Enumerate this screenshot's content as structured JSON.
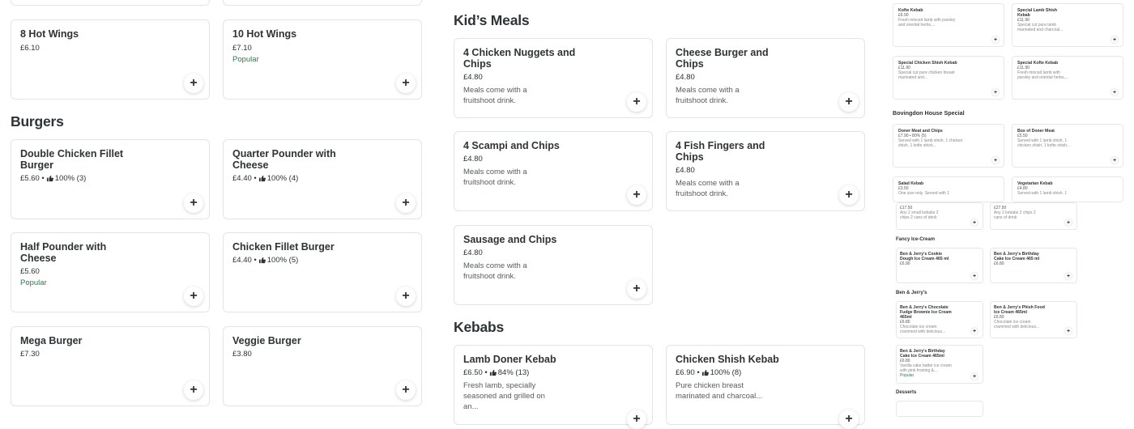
{
  "sections": {
    "burgers": "Burgers",
    "kids_meals": "Kid’s Meals",
    "kebabs": "Kebabs"
  },
  "wings": [
    {
      "title": "8 Hot Wings",
      "price": "£6.10",
      "tag": ""
    },
    {
      "title": "10 Hot Wings",
      "price": "£7.10",
      "tag": "Popular"
    }
  ],
  "burgers": [
    {
      "title": "Double Chicken Fillet Burger",
      "price": "£5.60 •",
      "rating": "100% (3)"
    },
    {
      "title": "Quarter Pounder with Cheese",
      "price": "£4.40 •",
      "rating": "100% (4)"
    },
    {
      "title": "Half Pounder with Cheese",
      "price": "£5.60",
      "tag": "Popular"
    },
    {
      "title": "Chicken Fillet Burger",
      "price": "£4.40 •",
      "rating": "100% (5)"
    },
    {
      "title": "Mega Burger",
      "price": "£7.30"
    },
    {
      "title": "Veggie Burger",
      "price": "£3.80"
    }
  ],
  "kids": [
    {
      "title": "4 Chicken Nuggets and Chips",
      "price": "£4.80",
      "desc": "Meals come with a fruitshoot drink."
    },
    {
      "title": "Cheese Burger and Chips",
      "price": "£4.80",
      "desc": "Meals come with a fruitshoot drink."
    },
    {
      "title": "4 Scampi and Chips",
      "price": "£4.80",
      "desc": "Meals come with a fruitshoot drink."
    },
    {
      "title": "4 Fish Fingers and Chips",
      "price": "£4.80",
      "desc": "Meals come with a fruitshoot drink."
    },
    {
      "title": "Sausage and Chips",
      "price": "£4.80",
      "desc": "Meals come with a fruitshoot drink."
    }
  ],
  "kebabs": [
    {
      "title": "Lamb Doner Kebab",
      "price": "£6.50 •",
      "rating": "84% (13)",
      "desc": "Fresh lamb, specially seasoned and grilled on an..."
    },
    {
      "title": "Chicken Shish Kebab",
      "price": "£6.90 •",
      "rating": "100% (8)",
      "desc": "Pure chicken breast marinated and charcoal..."
    }
  ],
  "plus_label": "+",
  "mini": {
    "top": [
      {
        "title": "Kofte Kebab",
        "price": "£6.90",
        "desc": "Fresh minced lamb with parsley and oriental herbs,..."
      },
      {
        "title": "Special Lamb Shish Kebab",
        "price": "£11.90",
        "desc": "Special cut pure lamb marinated and charcoal..."
      },
      {
        "title": "Special Chicken Shish Kebab",
        "price": "£11.90",
        "desc": "Special cut pure chicken breast marinated and..."
      },
      {
        "title": "Special Kofte Kebab",
        "price": "£11.90",
        "desc": "Fresh minced lamb with parsley and oriental herbs,..."
      }
    ],
    "bovingdon_heading": "Bovingdon House Special",
    "bovingdon": [
      {
        "title": "Doner Meat and Chips",
        "price": "£7.90 • 80% (5)",
        "desc": "Served with 1 lamb shish, 1 chicken shish, 1 kofte shish..."
      },
      {
        "title": "Box of Doner Meat",
        "price": "£5.50",
        "desc": "Served with 1 lamb shish, 1 chicken shish, 1 kofte shish..."
      },
      {
        "title": "Salad Kebab",
        "price": "£3.50",
        "desc": "One size only. Served with 1"
      },
      {
        "title": "Vegetarian Kebab",
        "price": "£4.80",
        "desc": "Served with 1 lamb shish. 1"
      }
    ],
    "small": [
      {
        "price": "£17.50",
        "desc": "Any 2 small kebabs 2 chips 2 cans of drink"
      },
      {
        "price": "£27.50",
        "desc": "Any 2 kebabs 2 chips 2 cans of drink"
      }
    ],
    "icecream_heading": "Fancy Ice-Cream",
    "icecream": [
      {
        "title": "Ben & Jerry's Cookie Dough Ice Cream 465 ml",
        "price": "£6.90"
      },
      {
        "title": "Ben & Jerry's Birthday Cake Ice Cream 465 ml",
        "price": "£6.80"
      }
    ],
    "bj_heading": "Ben & Jerry's",
    "bj": [
      {
        "title": "Ben & Jerry's Chocolate Fudge Brownie Ice Cream 465ml",
        "price": "£6.80",
        "desc": "Chocolate ice cream crammed with delicious..."
      },
      {
        "title": "Ben & Jerry's Phish Food Ice Cream 465ml",
        "price": "£6.80",
        "desc": "Chocolate ice cream crammed with delicious..."
      },
      {
        "title": "Ben & Jerry's Birthday Cake Ice Cream 465ml",
        "price": "£6.80",
        "desc": "Vanilla cake batter ice cream with pink frosting &...",
        "tag": "Popular"
      }
    ],
    "desserts_heading": "Desserts"
  }
}
